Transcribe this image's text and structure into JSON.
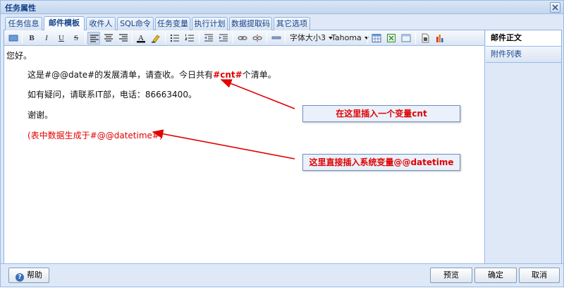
{
  "window": {
    "title": "任务属性"
  },
  "tabs": [
    "任务信息",
    "邮件模板",
    "收件人",
    "SQL命令",
    "任务变量",
    "执行计划",
    "数据提取码",
    "其它选项"
  ],
  "toolbar": {
    "font_size_label": "字体大小3",
    "font_family_label": "Tahoma",
    "bold_glyph": "B",
    "italic_glyph": "I",
    "underline_glyph": "U",
    "strike_glyph": "S",
    "font_color_glyph": "A"
  },
  "editor": {
    "line1": "您好。",
    "line2_prefix": "这是#@@date#的发展清单，请查收。今日共有",
    "line2_var": "#cnt#",
    "line2_suffix": "个清单。",
    "line3": "如有疑问，请联系IT部，电话：86663400。",
    "line4": "谢谢。",
    "line5": "(表中数据生成于#@@datetime#)"
  },
  "side": {
    "items": [
      "邮件正文",
      "附件列表"
    ]
  },
  "annotations": {
    "callout1": "在这里插入一个变量cnt",
    "callout2": "这里直接插入系统变量@@datetime"
  },
  "footer": {
    "help": "帮助",
    "preview": "预览",
    "ok": "确定",
    "cancel": "取消"
  },
  "colors": {
    "accent": "#15428b",
    "variable_red": "#e00000",
    "panel_bg": "#dfe8f6"
  }
}
